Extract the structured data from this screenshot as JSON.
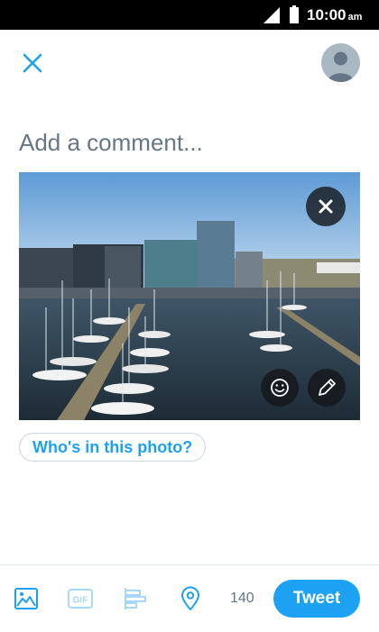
{
  "status_bar": {
    "time": "10:00",
    "ampm": "am",
    "icons": [
      "signal-icon",
      "battery-icon"
    ]
  },
  "header": {
    "close_icon": "close-icon",
    "avatar_icon": "avatar-icon"
  },
  "compose": {
    "placeholder": "Add a comment...",
    "value": ""
  },
  "photo": {
    "remove_icon": "close-icon",
    "sticker_icon": "smiley-icon",
    "edit_icon": "pencil-icon"
  },
  "tag_people": {
    "label": "Who's in this photo?"
  },
  "toolbar": {
    "items": [
      "image-icon",
      "gif-icon",
      "poll-icon",
      "location-icon"
    ],
    "gif_label": "GIF",
    "char_count": "140",
    "tweet_label": "Tweet"
  },
  "colors": {
    "accent": "#1da1f2",
    "muted": "#657786",
    "border": "#e1e8ed"
  }
}
